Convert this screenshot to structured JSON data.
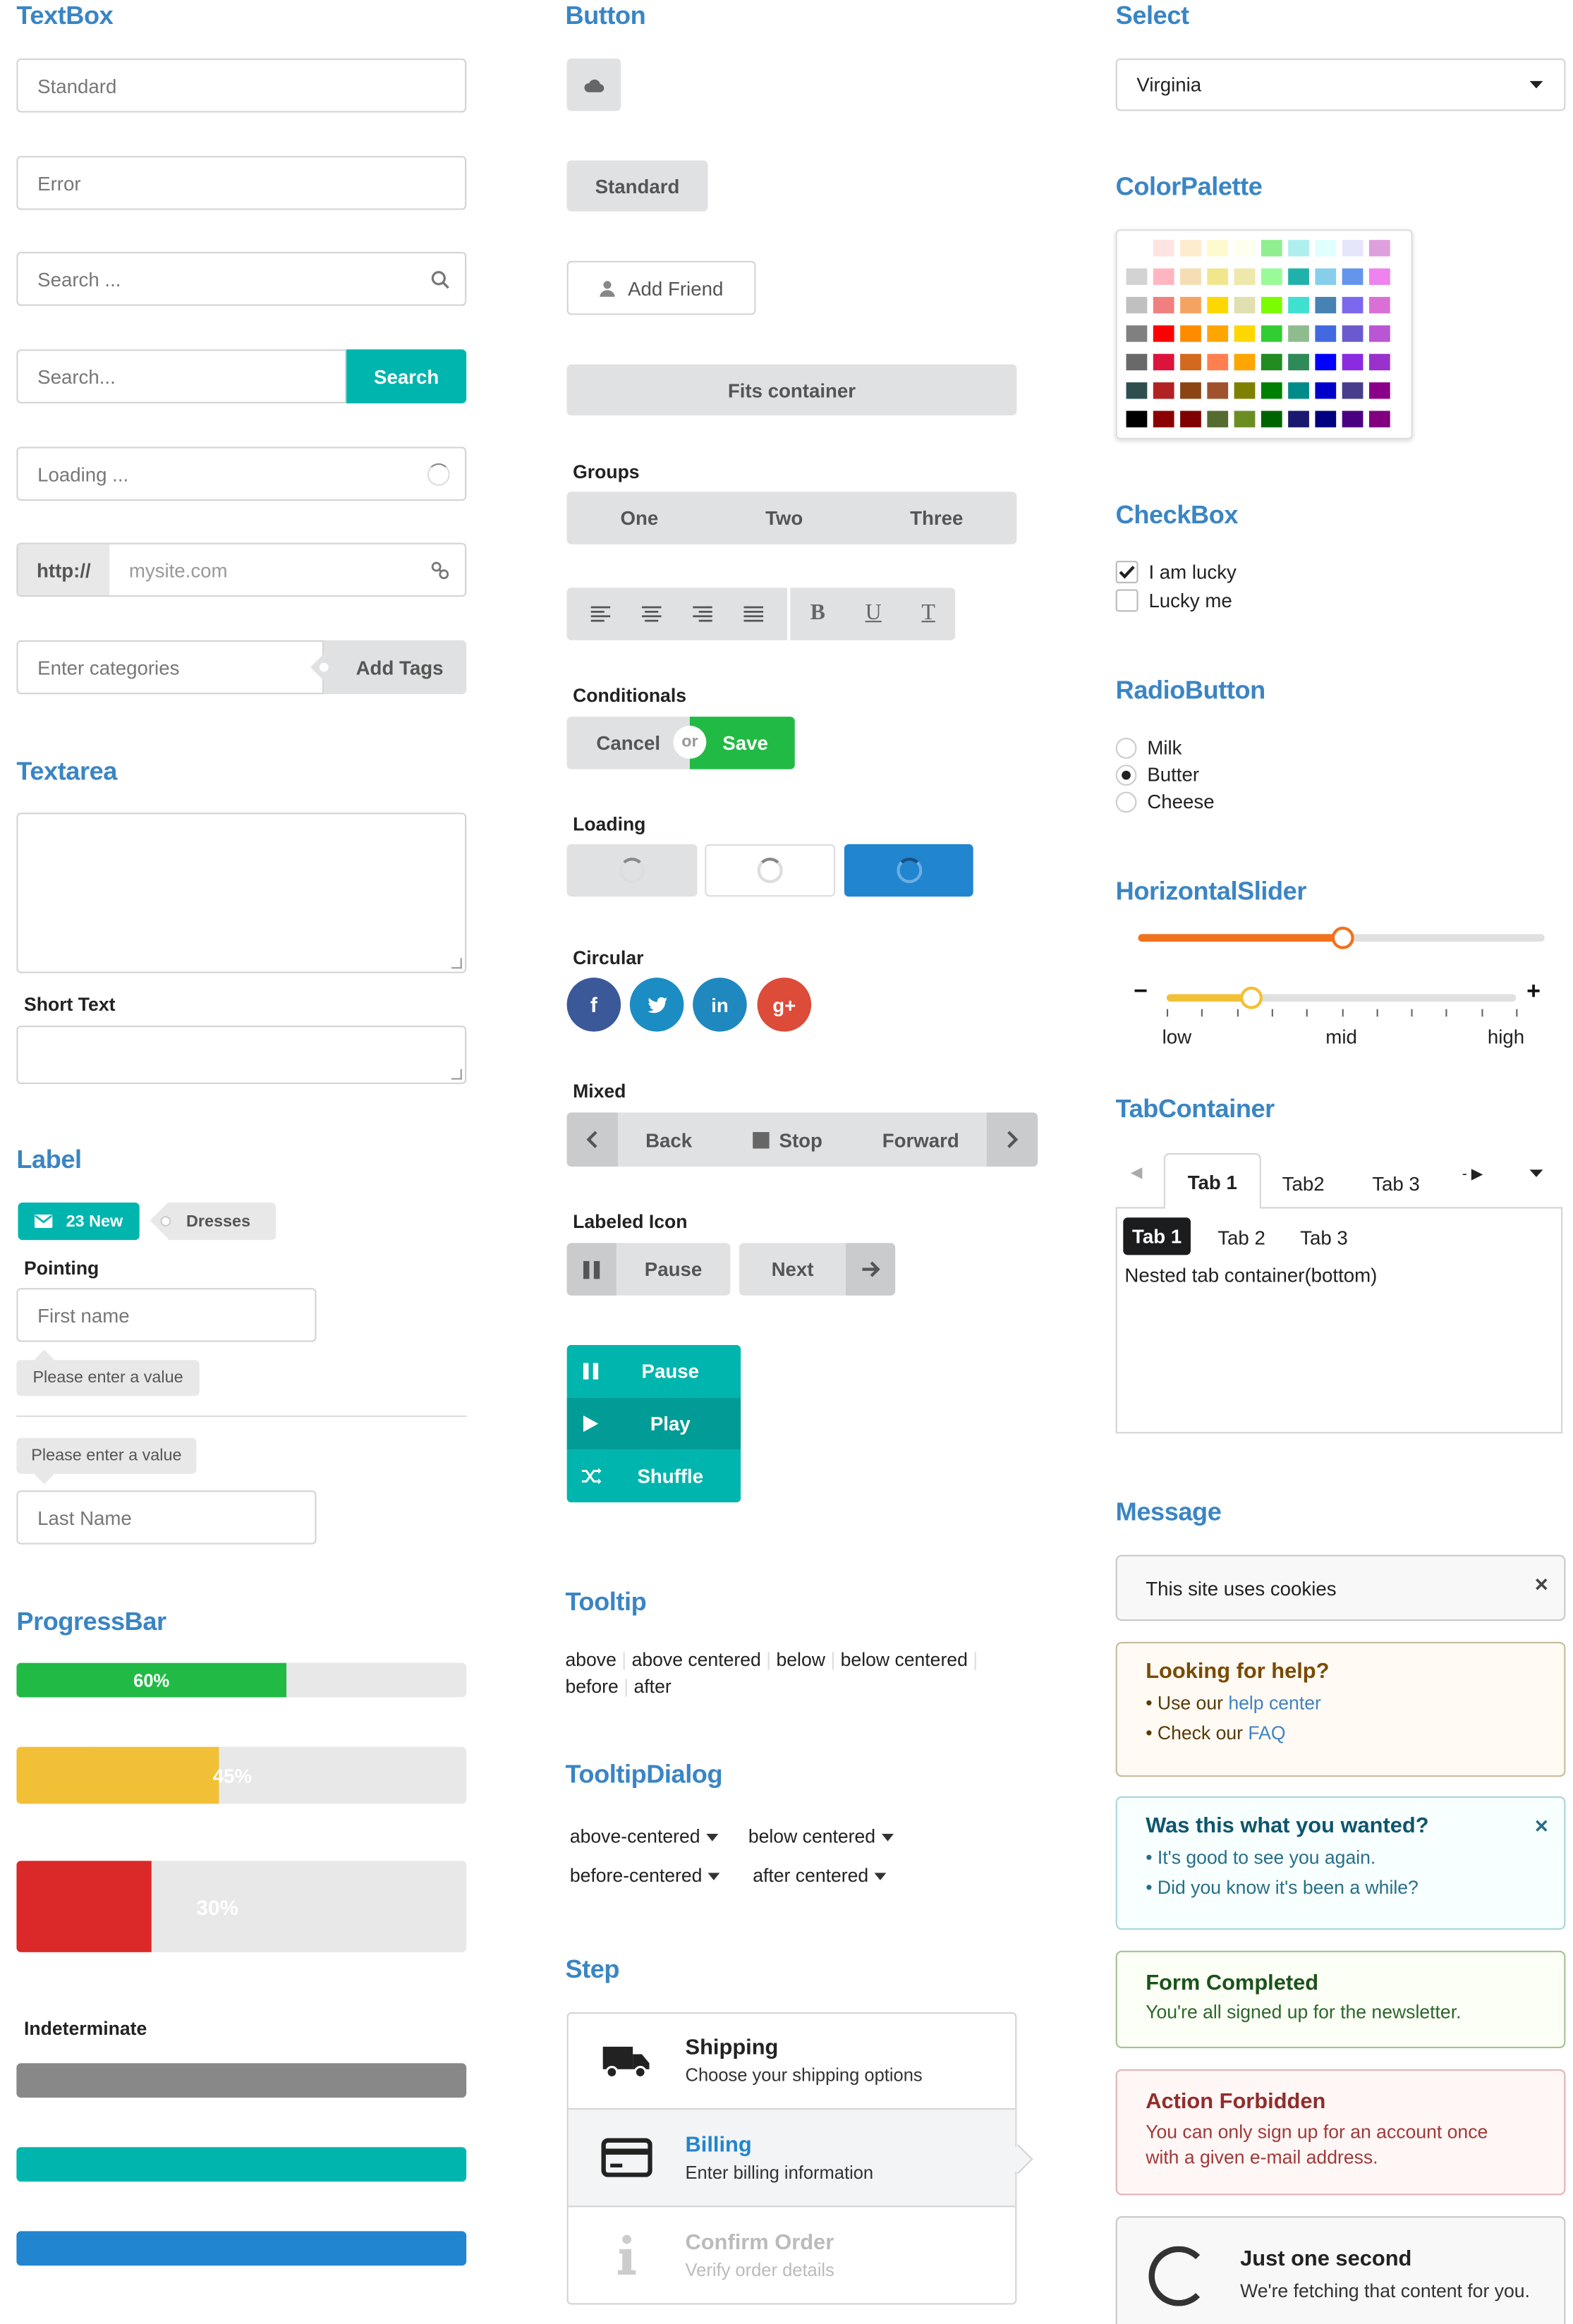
{
  "textbox": {
    "title": "TextBox",
    "standard_placeholder": "Standard",
    "error_placeholder": "Error",
    "search_placeholder": "Search ...",
    "search2_placeholder": "Search...",
    "search_button": "Search",
    "loading_placeholder": "Loading ...",
    "url_prefix": "http://",
    "url_placeholder": "mysite.com",
    "tags_placeholder": "Enter categories",
    "tags_button": "Add Tags"
  },
  "textarea": {
    "title": "Textarea",
    "short_label": "Short Text"
  },
  "label": {
    "title": "Label",
    "badge_count": "23 New",
    "tag_label": "Dresses",
    "pointing": "Pointing",
    "first_placeholder": "First name",
    "hint1": "Please enter a value",
    "hint2": "Please enter a value",
    "last_placeholder": "Last Name"
  },
  "progress": {
    "title": "ProgressBar",
    "bars": [
      {
        "label": "60%",
        "value": 0.6,
        "color": "#21ba45"
      },
      {
        "label": "45%",
        "value": 0.45,
        "color": "#f2c037"
      },
      {
        "label": "30%",
        "value": 0.3,
        "color": "#db2828"
      }
    ],
    "indeterminate": "Indeterminate",
    "ind_colors": [
      "#888888",
      "#00b5ad",
      "#2185d0"
    ]
  },
  "button": {
    "title": "Button",
    "standard": "Standard",
    "add_friend": "Add Friend",
    "fits": "Fits container",
    "groups": "Groups",
    "group_items": [
      "One",
      "Two",
      "Three"
    ],
    "conditionals": "Conditionals",
    "cancel": "Cancel",
    "or": "or",
    "save": "Save",
    "loading": "Loading",
    "circular": "Circular",
    "social": [
      "f",
      "t",
      "in",
      "g+"
    ],
    "mixed": "Mixed",
    "back": "Back",
    "stop": "Stop",
    "forward": "Forward",
    "labeled_icon": "Labeled Icon",
    "pause": "Pause",
    "next": "Next",
    "vertical": [
      "Pause",
      "Play",
      "Shuffle"
    ],
    "accent_teal": "#00b5ad",
    "accent_blue": "#2185d0",
    "accent_green": "#21ba45"
  },
  "tooltip": {
    "title": "Tooltip",
    "items": [
      "above",
      "above centered",
      "below",
      "below centered",
      "before",
      "after"
    ]
  },
  "tooltipdialog": {
    "title": "TooltipDialog",
    "items": [
      "above-centered",
      "below centered",
      "before-centered",
      "after centered"
    ]
  },
  "step": {
    "title": "Step",
    "steps": [
      {
        "title": "Shipping",
        "desc": "Choose your shipping options",
        "icon": "truck-icon"
      },
      {
        "title": "Billing",
        "desc": "Enter billing information",
        "icon": "credit-card-icon"
      },
      {
        "title": "Confirm Order",
        "desc": "Verify order details",
        "icon": "info-icon"
      }
    ]
  },
  "select": {
    "title": "Select",
    "value": "Virginia"
  },
  "colorpalette": {
    "title": "ColorPalette"
  },
  "checkbox": {
    "title": "CheckBox",
    "items": [
      {
        "label": "I am lucky",
        "checked": true
      },
      {
        "label": "Lucky me",
        "checked": false
      }
    ]
  },
  "radio": {
    "title": "RadioButton",
    "items": [
      {
        "label": "Milk",
        "checked": false
      },
      {
        "label": "Butter",
        "checked": true
      },
      {
        "label": "Cheese",
        "checked": false
      }
    ]
  },
  "slider": {
    "title": "HorizontalSlider",
    "value1": 0.5,
    "value2": 0.24,
    "minus": "−",
    "plus": "+",
    "labels": [
      "low",
      "mid",
      "high"
    ]
  },
  "tabs": {
    "title": "TabContainer",
    "outer": [
      "Tab 1",
      "Tab2",
      "Tab 3"
    ],
    "inner": [
      "Tab 1",
      "Tab 2",
      "Tab 3"
    ],
    "content": "Nested tab container(bottom)"
  },
  "message": {
    "title": "Message",
    "cookies": "This site uses cookies",
    "help_title": "Looking for help?",
    "help_1_prefix": "Use our ",
    "help_1_link": "help center",
    "help_2_prefix": "Check our ",
    "help_2_link": "FAQ",
    "wanted_title": "Was this what you wanted?",
    "wanted_1": "It's good to see you again.",
    "wanted_2": "Did you know it's been a while?",
    "form_title": "Form Completed",
    "form_text": "You're all signed up for the newsletter.",
    "forbid_title": "Action Forbidden",
    "forbid_text": "You can only sign up for an account once with a given e-mail address.",
    "wait_title": "Just one second",
    "wait_text": "We're fetching that content for you."
  }
}
